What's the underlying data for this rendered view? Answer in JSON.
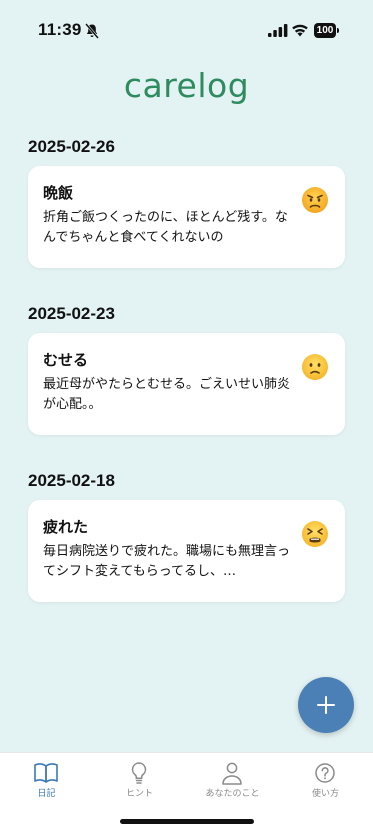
{
  "status_bar": {
    "time": "11:39",
    "battery": "100"
  },
  "app": {
    "title": "carelog"
  },
  "entries": [
    {
      "date": "2025-02-26",
      "title": "晩飯",
      "body": "折角ご飯つくったのに、ほとんど残す。なんでちゃんと食べてくれないの",
      "mood": "angry"
    },
    {
      "date": "2025-02-23",
      "title": "むせる",
      "body": "最近母がやたらとむせる。ごえいせい肺炎が心配。。",
      "mood": "worried"
    },
    {
      "date": "2025-02-18",
      "title": "疲れた",
      "body": "毎日病院送りで疲れた。職場にも無理言ってシフト変えてもらってるし、…",
      "mood": "tired"
    }
  ],
  "fab": {
    "icon": "plus-icon"
  },
  "tabs": [
    {
      "label": "日記",
      "icon": "book-icon",
      "active": true
    },
    {
      "label": "ヒント",
      "icon": "lightbulb-icon",
      "active": false
    },
    {
      "label": "あなたのこと",
      "icon": "person-icon",
      "active": false
    },
    {
      "label": "使い方",
      "icon": "help-icon",
      "active": false
    }
  ],
  "colors": {
    "background": "#e3f2f2",
    "brand_green": "#2e8b5e",
    "accent_blue": "#4a80b6",
    "tab_active": "#3d79b8"
  }
}
